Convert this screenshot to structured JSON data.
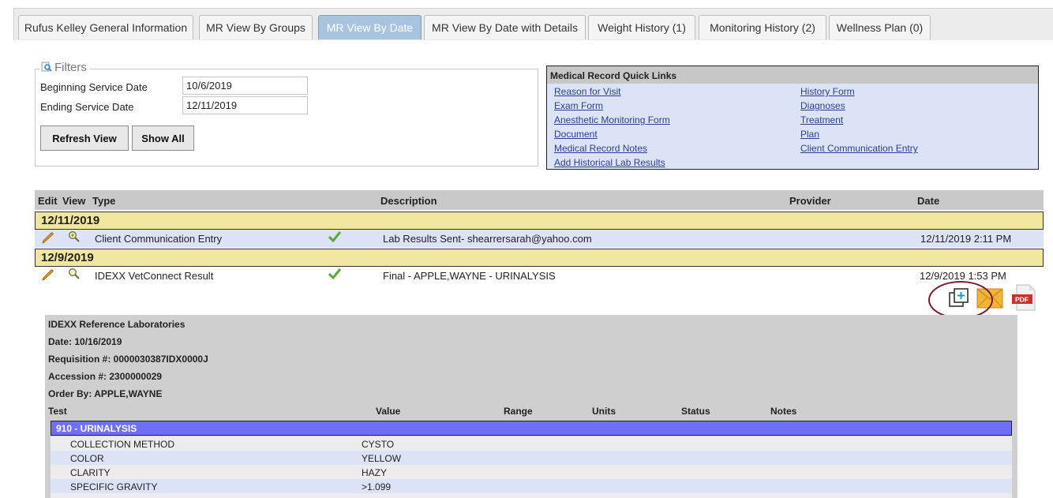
{
  "tabs": [
    {
      "label": "Rufus Kelley General Information",
      "active": false
    },
    {
      "label": "MR View By Groups",
      "active": false
    },
    {
      "label": "MR View By Date",
      "active": true
    },
    {
      "label": "MR View By Date with Details",
      "active": false
    },
    {
      "label": "Weight History (1)",
      "active": false
    },
    {
      "label": "Monitoring History (2)",
      "active": false
    },
    {
      "label": "Wellness Plan (0)",
      "active": false
    }
  ],
  "filters": {
    "legend": "Filters",
    "begin_label": "Beginning Service Date",
    "begin_value": "10/6/2019",
    "end_label": "Ending Service Date",
    "end_value": "12/11/2019",
    "refresh_label": "Refresh View",
    "show_all_label": "Show All"
  },
  "quick_links": {
    "title": "Medical Record Quick Links",
    "left": [
      "Reason for Visit",
      "Exam Form",
      "Anesthetic Monitoring Form",
      "Document",
      "Medical Record Notes",
      "Add Historical Lab Results"
    ],
    "right": [
      "History Form",
      "Diagnoses",
      "Treatment",
      "Plan",
      "Client Communication Entry"
    ]
  },
  "grid": {
    "headers": {
      "edit": "Edit",
      "view": "View",
      "type": "Type",
      "description": "Description",
      "provider": "Provider",
      "date": "Date"
    },
    "groups": [
      {
        "date": "12/11/2019",
        "records": [
          {
            "type": "Client Communication Entry",
            "description": "Lab Results Sent- shearrersarah@yahoo.com",
            "provider": "",
            "date": "12/11/2019 2:11 PM"
          }
        ]
      },
      {
        "date": "12/9/2019",
        "records": [
          {
            "type": "IDEXX VetConnect Result",
            "description": "Final - APPLE,WAYNE - URINALYSIS",
            "provider": "",
            "date": "12/9/2019 1:53 PM"
          }
        ]
      }
    ]
  },
  "icons": {
    "edit": "pencil-icon",
    "view": "magnifier-icon",
    "status": "checkmark-icon",
    "copy": "copy-plus-icon",
    "email": "envelope-icon",
    "pdf": "pdf-icon"
  },
  "report": {
    "lab": "IDEXX Reference Laboratories",
    "date": "Date: 10/16/2019",
    "requisition": "Requisition #: 0000030387IDX0000J",
    "accession": "Accession #: 2300000029",
    "order_by": "Order By: APPLE,WAYNE",
    "columns": {
      "test": "Test",
      "value": "Value",
      "range": "Range",
      "units": "Units",
      "status": "Status",
      "notes": "Notes"
    },
    "section": "910 - URINALYSIS",
    "results": [
      {
        "test": "COLLECTION METHOD",
        "value": "CYSTO"
      },
      {
        "test": "COLOR",
        "value": "YELLOW"
      },
      {
        "test": "CLARITY",
        "value": "HAZY"
      },
      {
        "test": "SPECIFIC GRAVITY",
        "value": ">1.099"
      }
    ]
  },
  "colors": {
    "active_tab": "#a8c4dc",
    "date_row": "#f0e6a0",
    "alt_row": "#dde3f7",
    "section": "#6f6ff5",
    "link": "#2a3f8f",
    "highlight_ring": "#7a1a2a"
  }
}
